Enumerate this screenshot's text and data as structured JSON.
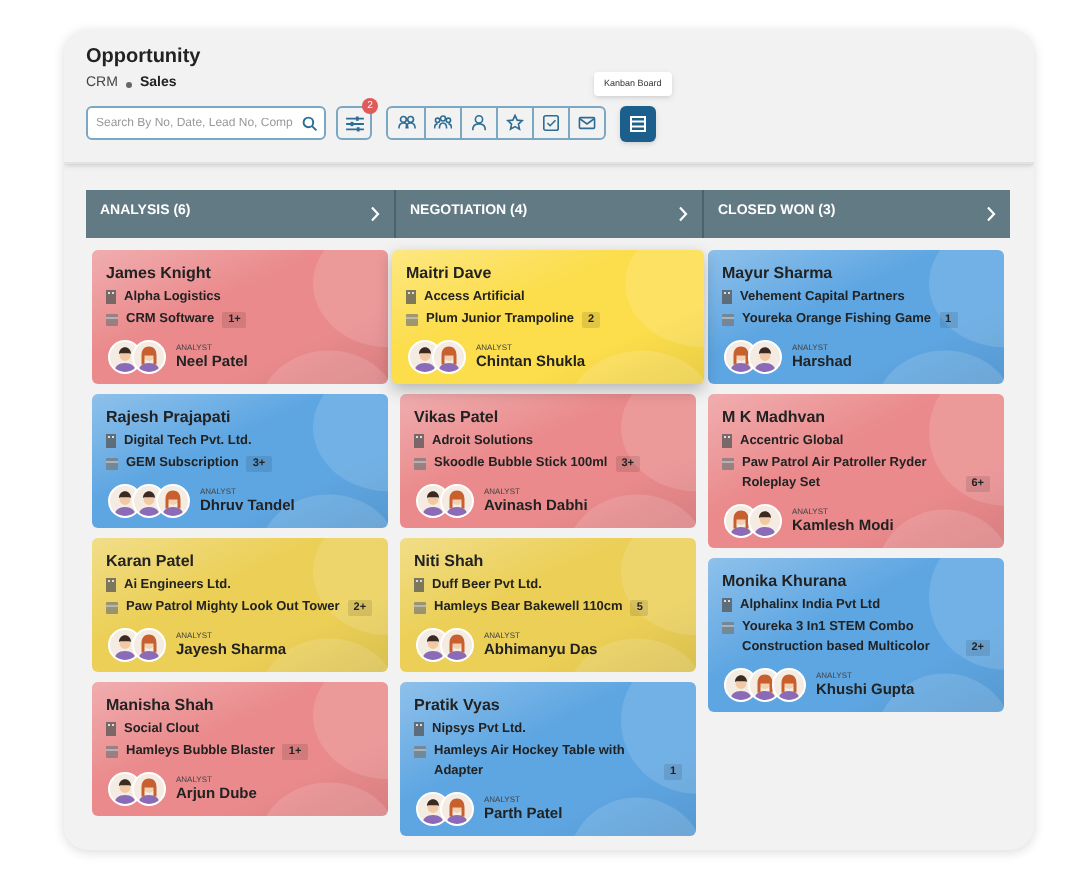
{
  "page": {
    "title": "Opportunity",
    "breadcrumb": [
      "CRM",
      "Sales"
    ]
  },
  "toolbar": {
    "search": {
      "placeholder": "Search By No, Date, Lead No, Comp"
    },
    "filter_badge": "2",
    "view_buttons": [
      {
        "kind": "group"
      },
      {
        "kind": "team"
      },
      {
        "kind": "person"
      },
      {
        "kind": "star"
      },
      {
        "kind": "task"
      },
      {
        "kind": "mail"
      }
    ],
    "kanban_button": {
      "selected": true,
      "tooltip": "Kanban Board"
    }
  },
  "columns": [
    {
      "title": "ANALYSIS (6)",
      "cards": [
        {
          "color": "#ea8a8c",
          "name": "James Knight",
          "company": "Alpha Logistics",
          "product": "CRM Software",
          "count": "1+",
          "role": "ANALYST",
          "analyst": "Neel Patel",
          "avatars": [
            {
              "kind": "man"
            },
            {
              "kind": "woman"
            }
          ]
        },
        {
          "color": "#5ea6e2",
          "name": "Rajesh Prajapati",
          "company": "Digital Tech Pvt. Ltd.",
          "product": "GEM Subscription",
          "count": "3+",
          "role": "ANALYST",
          "analyst": "Dhruv Tandel",
          "avatars": [
            {
              "kind": "man"
            },
            {
              "kind": "man"
            },
            {
              "kind": "woman"
            }
          ]
        },
        {
          "color": "#ebcf56",
          "name": "Karan Patel",
          "company": "Ai Engineers Ltd.",
          "product": "Paw Patrol Mighty Look Out Tower",
          "count": "2+",
          "role": "ANALYST",
          "analyst": "Jayesh Sharma",
          "avatars": [
            {
              "kind": "man"
            },
            {
              "kind": "woman"
            }
          ]
        },
        {
          "color": "#ea8a8c",
          "name": "Manisha Shah",
          "company": "Social Clout",
          "product": "Hamleys Bubble Blaster",
          "count": "1+",
          "role": "ANALYST",
          "analyst": "Arjun Dube",
          "avatars": [
            {
              "kind": "man"
            },
            {
              "kind": "woman"
            }
          ]
        }
      ]
    },
    {
      "title": "NEGOTIATION (4)",
      "cards": [
        {
          "color": "#fcdd4b",
          "name": "Maitri Dave",
          "company": "Access Artificial",
          "product": "Plum Junior Trampoline",
          "count": "2",
          "role": "ANALYST",
          "analyst": "Chintan Shukla",
          "avatars": [
            {
              "kind": "man"
            },
            {
              "kind": "woman"
            }
          ]
        },
        {
          "color": "#ea8a8c",
          "name": "Vikas Patel",
          "company": "Adroit Solutions",
          "product": "Skoodle Bubble Stick 100ml",
          "count": "3+",
          "role": "ANALYST",
          "analyst": "Avinash Dabhi",
          "avatars": [
            {
              "kind": "man"
            },
            {
              "kind": "woman"
            }
          ]
        },
        {
          "color": "#ebcf56",
          "name": "Niti Shah",
          "company": "Duff Beer Pvt Ltd.",
          "product": "Hamleys Bear Bakewell 110cm",
          "count": "5",
          "role": "ANALYST",
          "analyst": "Abhimanyu Das",
          "avatars": [
            {
              "kind": "man"
            },
            {
              "kind": "woman"
            }
          ]
        },
        {
          "color": "#5ea6e2",
          "name": "Pratik Vyas",
          "company": "Nipsys Pvt Ltd.",
          "product": "Hamleys Air Hockey Table with Adapter",
          "count": "1",
          "role": "ANALYST",
          "analyst": "Parth Patel",
          "avatars": [
            {
              "kind": "man"
            },
            {
              "kind": "woman"
            }
          ]
        }
      ]
    },
    {
      "title": "CLOSED WON (3)",
      "cards": [
        {
          "color": "#5ea6e2",
          "name": "Mayur Sharma",
          "company": "Vehement Capital Partners",
          "product": "Youreka Orange Fishing Game",
          "count": "1",
          "role": "ANALYST",
          "analyst": "Harshad",
          "avatars": [
            {
              "kind": "woman"
            },
            {
              "kind": "man"
            }
          ]
        },
        {
          "color": "#ea8a8c",
          "name": "M K Madhvan",
          "company": "Accentric Global",
          "product": "Paw Patrol Air Patroller Ryder Roleplay Set",
          "count": "6+",
          "role": "ANALYST",
          "analyst": "Kamlesh Modi",
          "avatars": [
            {
              "kind": "woman"
            },
            {
              "kind": "man"
            }
          ]
        },
        {
          "color": "#5ea6e2",
          "name": "Monika Khurana",
          "company": "Alphalinx India Pvt Ltd",
          "product": "Youreka 3 In1 STEM Combo Construction based Multicolor",
          "count": "2+",
          "role": "ANALYST",
          "analyst": "Khushi Gupta",
          "avatars": [
            {
              "kind": "man"
            },
            {
              "kind": "woman"
            },
            {
              "kind": "woman"
            }
          ]
        }
      ]
    }
  ]
}
